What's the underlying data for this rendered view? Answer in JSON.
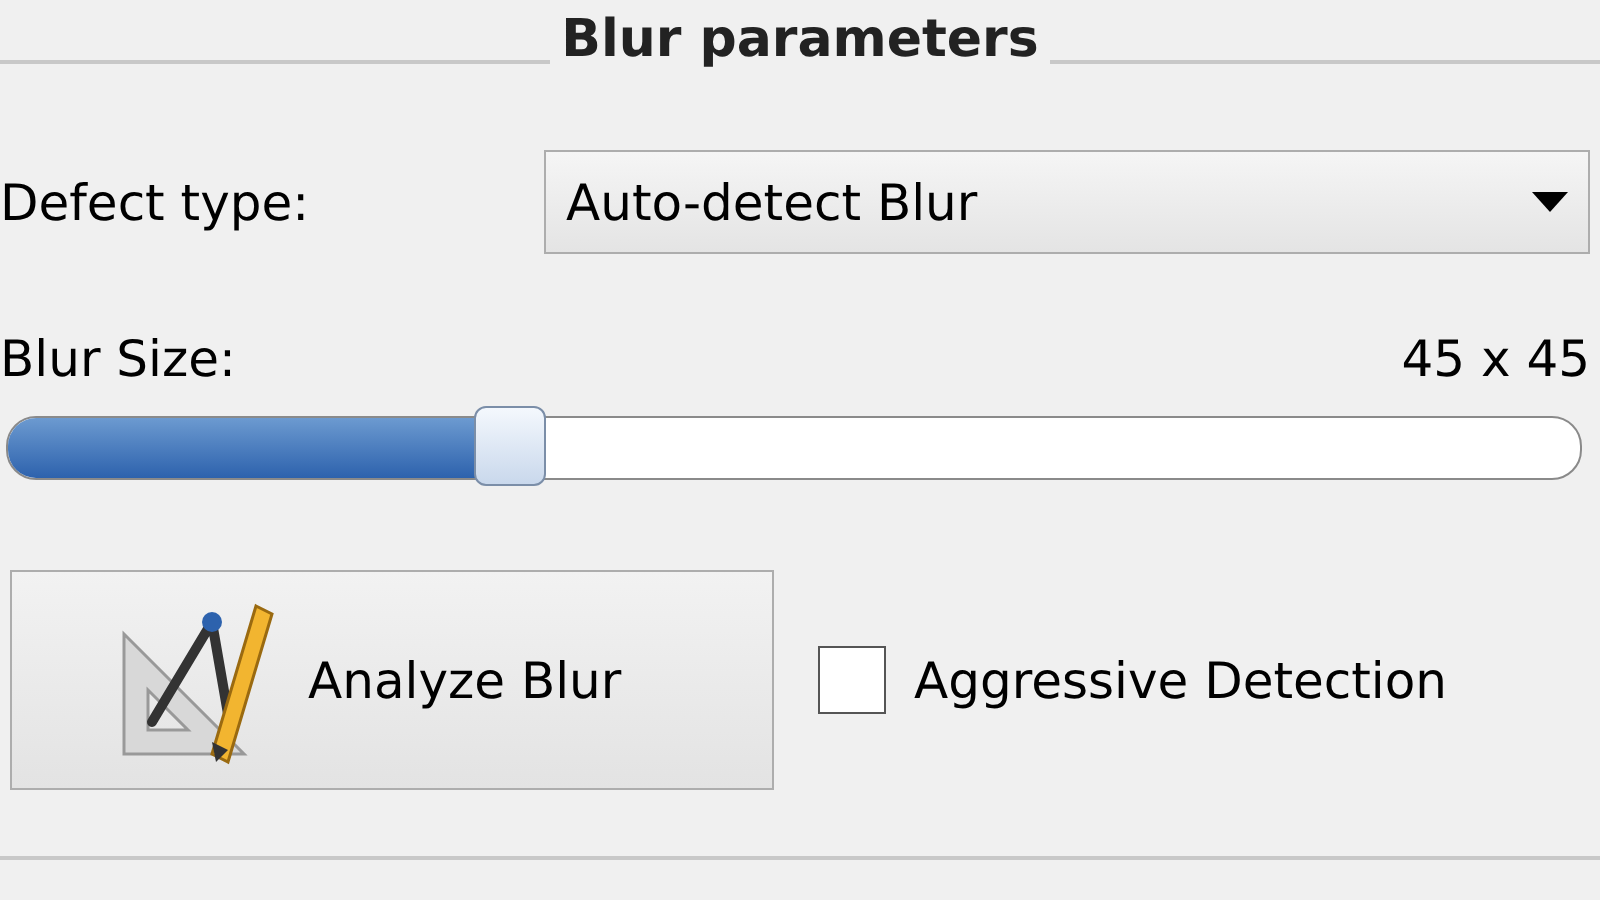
{
  "group": {
    "title": "Blur parameters"
  },
  "defect_type": {
    "label": "Defect type:",
    "value": "Auto-detect Blur"
  },
  "blur_size": {
    "label": "Blur Size:",
    "reading": "45 x 45",
    "level": 0.32
  },
  "analyze_button": {
    "label": "Analyze Blur"
  },
  "aggressive_detection": {
    "label": "Aggressive Detection",
    "checked": false
  }
}
